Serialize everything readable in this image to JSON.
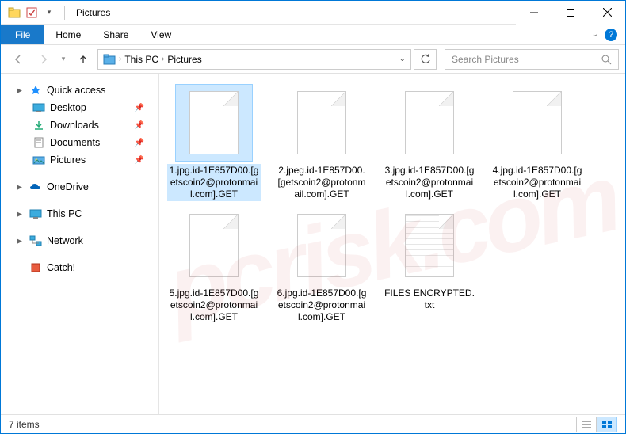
{
  "window": {
    "title": "Pictures"
  },
  "ribbon": {
    "file": "File",
    "home": "Home",
    "share": "Share",
    "view": "View"
  },
  "address": {
    "crumbs": [
      "This PC",
      "Pictures"
    ]
  },
  "search": {
    "placeholder": "Search Pictures"
  },
  "sidebar": {
    "quick_access": "Quick access",
    "items": [
      "Desktop",
      "Downloads",
      "Documents",
      "Pictures"
    ],
    "onedrive": "OneDrive",
    "this_pc": "This PC",
    "network": "Network",
    "catch": "Catch!"
  },
  "files": [
    {
      "name": "1.jpg.id-1E857D00.[getscoin2@protonmail.com].GET",
      "type": "blank",
      "selected": true
    },
    {
      "name": "2.jpeg.id-1E857D00.[getscoin2@protonmail.com].GET",
      "type": "blank",
      "selected": false
    },
    {
      "name": "3.jpg.id-1E857D00.[getscoin2@protonmail.com].GET",
      "type": "blank",
      "selected": false
    },
    {
      "name": "4.jpg.id-1E857D00.[getscoin2@protonmail.com].GET",
      "type": "blank",
      "selected": false
    },
    {
      "name": "5.jpg.id-1E857D00.[getscoin2@protonmail.com].GET",
      "type": "blank",
      "selected": false
    },
    {
      "name": "6.jpg.id-1E857D00.[getscoin2@protonmail.com].GET",
      "type": "blank",
      "selected": false
    },
    {
      "name": "FILES ENCRYPTED.txt",
      "type": "text",
      "selected": false
    }
  ],
  "status": {
    "item_count": "7 items"
  },
  "watermark": "pcrisk.com"
}
